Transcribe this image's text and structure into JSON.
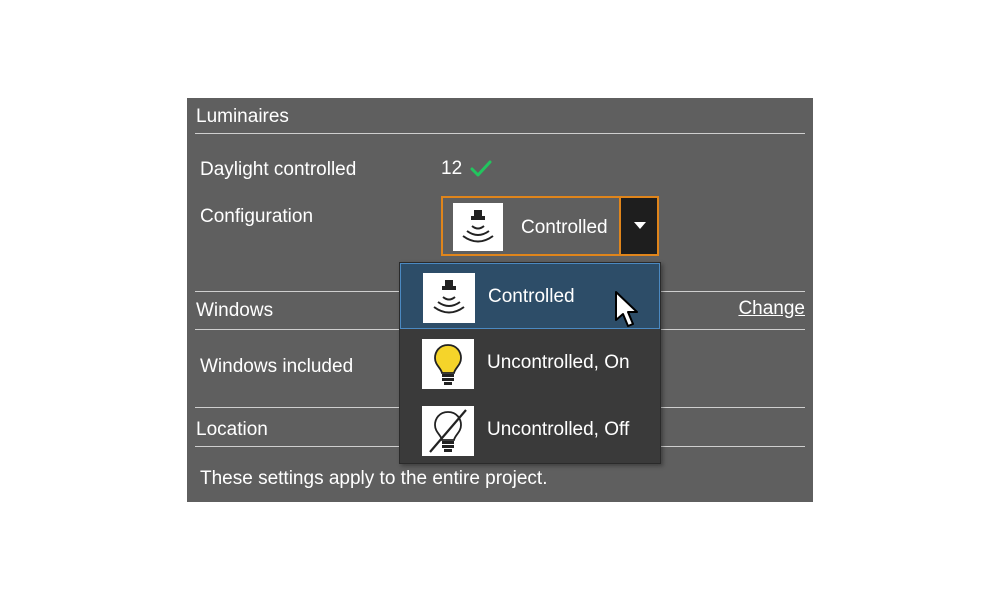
{
  "sections": {
    "luminaires": {
      "title": "Luminaires"
    },
    "windows": {
      "title": "Windows",
      "change_link": "Change"
    },
    "location": {
      "title": "Location"
    }
  },
  "rows": {
    "daylight_controlled": {
      "label": "Daylight controlled",
      "value": "12",
      "status_icon": "check-icon",
      "status_color": "#22c55e"
    },
    "configuration": {
      "label": "Configuration"
    },
    "windows_included": {
      "label": "Windows included"
    }
  },
  "configuration_combo": {
    "selected": "Controlled",
    "icon": "sensor-icon",
    "border_color": "#e0851b"
  },
  "dropdown": {
    "options": [
      {
        "label": "Controlled",
        "icon": "sensor-icon",
        "selected": true
      },
      {
        "label": "Uncontrolled, On",
        "icon": "lightbulb-on-icon",
        "selected": false
      },
      {
        "label": "Uncontrolled, Off",
        "icon": "lightbulb-off-icon",
        "selected": false
      }
    ],
    "highlight_color": "#2d4d68"
  },
  "footer": {
    "note": "These settings apply to the entire project."
  },
  "colors": {
    "panel": "#5f5f5f",
    "accent": "#e0851b",
    "dropdown_bg": "#3a3a3a"
  }
}
